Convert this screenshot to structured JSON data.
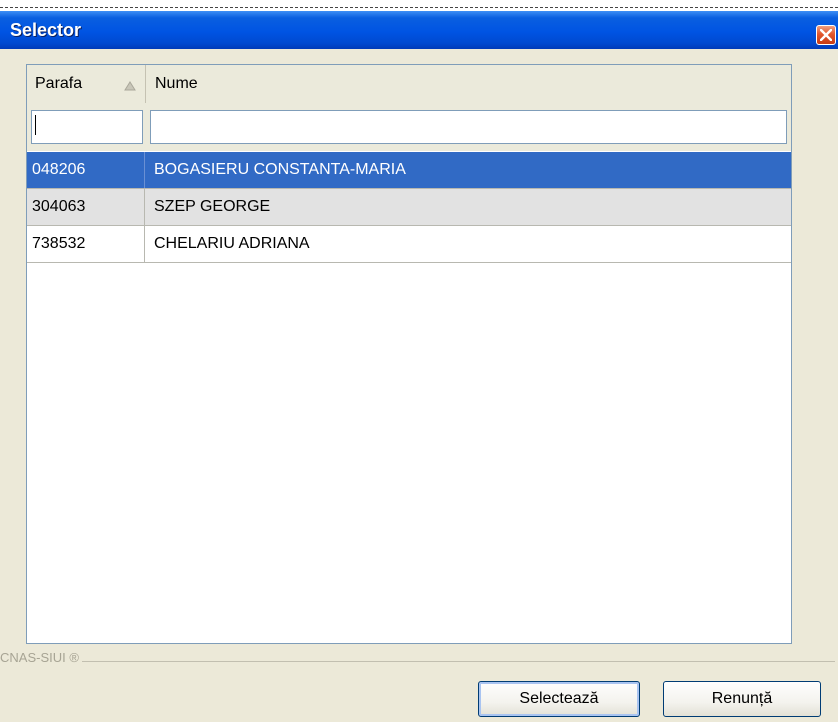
{
  "window": {
    "title": "Selector"
  },
  "grid": {
    "columns": [
      {
        "label": "Parafa",
        "sorted": "ascending"
      },
      {
        "label": "Nume"
      }
    ],
    "filters": {
      "parafa_value": "",
      "nume_value": ""
    },
    "rows": [
      {
        "parafa": "048206",
        "nume": "BOGASIERU CONSTANTA-MARIA",
        "selected": true
      },
      {
        "parafa": "304063",
        "nume": "SZEP GEORGE",
        "selected": false
      },
      {
        "parafa": "738532",
        "nume": "CHELARIU ADRIANA",
        "selected": false
      }
    ]
  },
  "footer": {
    "group_label": "CNAS-SIUI ®",
    "select_label": "Selectează",
    "cancel_label": "Renunță"
  },
  "icons": {
    "close": "close-icon",
    "sort": "sort-ascending-icon"
  },
  "colors": {
    "titlebar": "#0054e3",
    "selection": "#316ac5",
    "window_bg": "#ece9d8"
  }
}
